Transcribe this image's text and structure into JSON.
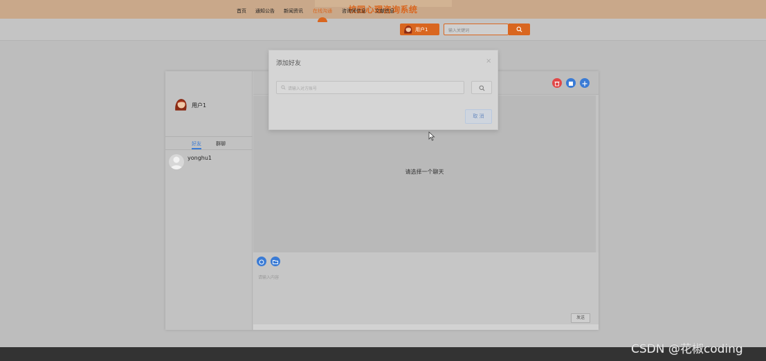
{
  "header": {
    "site_title": "校园心理咨询系统"
  },
  "nav": {
    "items": [
      {
        "label": "首页",
        "active": false
      },
      {
        "label": "通知公告",
        "active": false
      },
      {
        "label": "新闻资讯",
        "active": false
      },
      {
        "label": "在线沟通",
        "active": true
      },
      {
        "label": "咨询师信息",
        "active": false
      },
      {
        "label": "文献信息",
        "active": false
      }
    ],
    "user_label": "用户1",
    "search_placeholder": "输入关键词",
    "accent": "#d9661f"
  },
  "chat": {
    "me_name": "用户1",
    "tabs": [
      "好友",
      "群聊"
    ],
    "active_tab": "好友",
    "friends": [
      {
        "name": "yonghu1"
      }
    ],
    "empty_message": "请选择一个聊天",
    "composer_placeholder": "请输入内容",
    "send_label": "发送",
    "header_buttons": [
      {
        "icon": "delete-icon",
        "color": "#e04848"
      },
      {
        "icon": "group-icon",
        "color": "#3a7bd5"
      },
      {
        "icon": "plus-icon",
        "color": "#3a7bd5"
      }
    ],
    "tools": [
      {
        "icon": "emoji-icon"
      },
      {
        "icon": "folder-icon"
      }
    ]
  },
  "modal": {
    "title": "添加好友",
    "close": "×",
    "input_placeholder": "请输入对方账号",
    "cancel_label": "取 消"
  },
  "watermark": "CSDN @花椒coding"
}
